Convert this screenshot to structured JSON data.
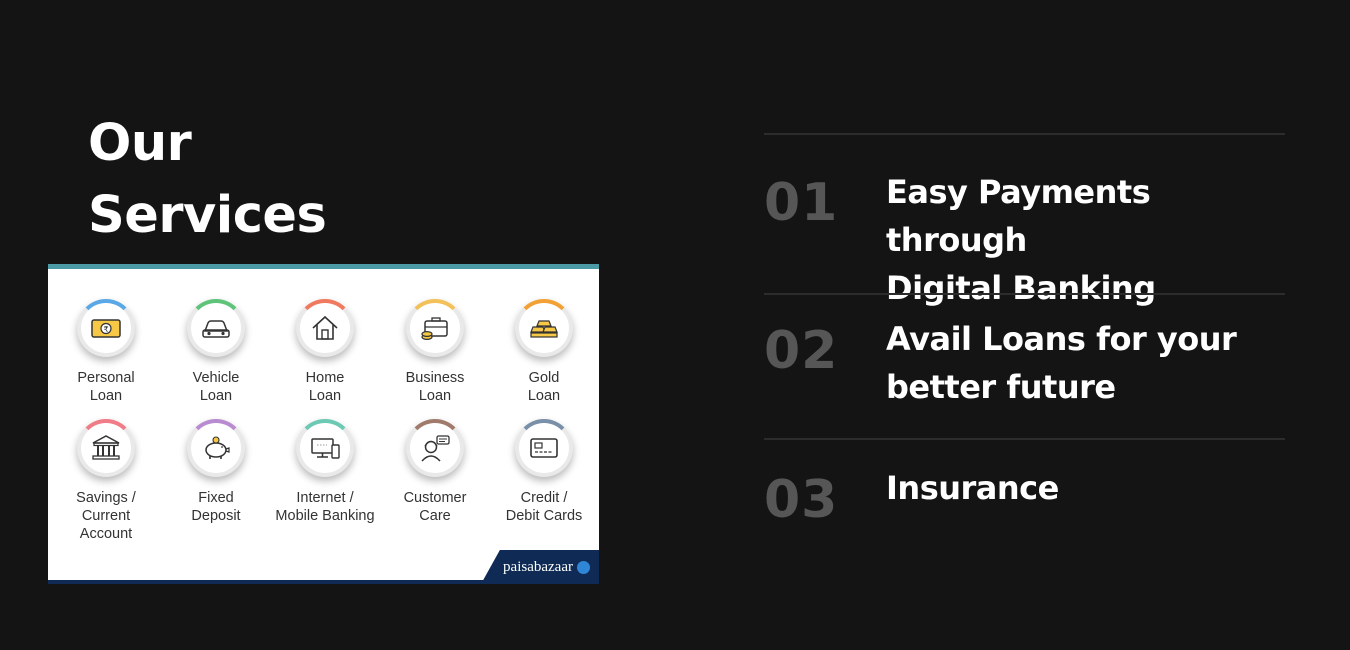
{
  "heading": {
    "line1": "Our",
    "line2": "Services"
  },
  "services": [
    {
      "label1": "Personal",
      "label2": "Loan",
      "label3": "",
      "icon": "rupee-note-icon",
      "color": "#5aa9e6"
    },
    {
      "label1": "Vehicle",
      "label2": "Loan",
      "label3": "",
      "icon": "car-icon",
      "color": "#5fc37a"
    },
    {
      "label1": "Home",
      "label2": "Loan",
      "label3": "",
      "icon": "house-icon",
      "color": "#f07a5f"
    },
    {
      "label1": "Business",
      "label2": "Loan",
      "label3": "",
      "icon": "briefcase-icon",
      "color": "#f3c15a"
    },
    {
      "label1": "Gold",
      "label2": "Loan",
      "label3": "",
      "icon": "gold-bars-icon",
      "color": "#f2a136"
    },
    {
      "label1": "Savings /",
      "label2": "Current",
      "label3": "Account",
      "icon": "bank-icon",
      "color": "#ef7c86"
    },
    {
      "label1": "Fixed",
      "label2": "Deposit",
      "label3": "",
      "icon": "piggy-bank-icon",
      "color": "#b98bd0"
    },
    {
      "label1": "Internet /",
      "label2": "Mobile Banking",
      "label3": "",
      "icon": "devices-icon",
      "color": "#6cc9b4"
    },
    {
      "label1": "Customer",
      "label2": "Care",
      "label3": "",
      "icon": "support-agent-icon",
      "color": "#a07a6a"
    },
    {
      "label1": "Credit /",
      "label2": "Debit Cards",
      "label3": "",
      "icon": "credit-card-icon",
      "color": "#7a8fa8"
    }
  ],
  "brand": {
    "name": "paisabazaar"
  },
  "features": [
    {
      "num": "01",
      "line1": "Easy Payments through",
      "line2": "Digital Banking"
    },
    {
      "num": "02",
      "line1": "Avail Loans for your",
      "line2": "better future"
    },
    {
      "num": "03",
      "line1": "Insurance",
      "line2": ""
    }
  ]
}
